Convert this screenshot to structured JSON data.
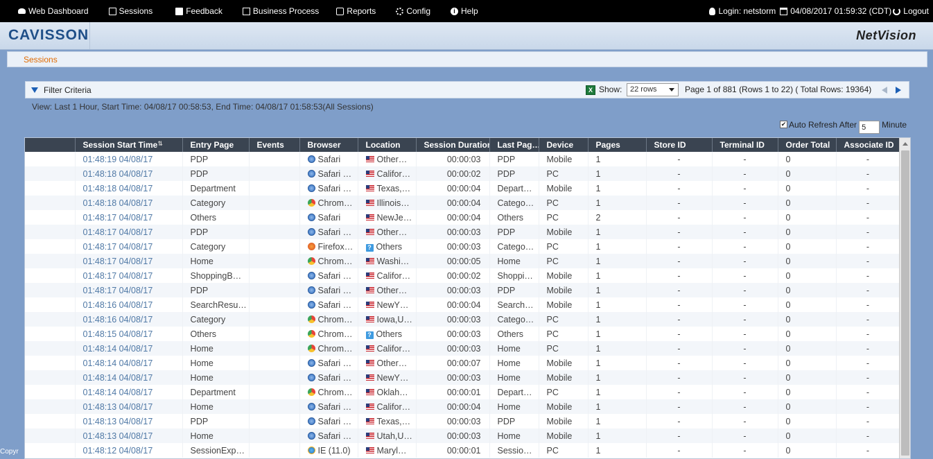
{
  "topnav": {
    "items": [
      {
        "label": "Web Dashboard",
        "icon": "dashboard-icon"
      },
      {
        "label": "Sessions",
        "icon": "sessions-icon"
      },
      {
        "label": "Feedback",
        "icon": "feedback-icon"
      },
      {
        "label": "Business Process",
        "icon": "business-process-icon"
      },
      {
        "label": "Reports",
        "icon": "reports-icon"
      },
      {
        "label": "Config",
        "icon": "config-icon"
      },
      {
        "label": "Help",
        "icon": "help-icon"
      }
    ],
    "login": "Login: netstorm",
    "datetime": "04/08/2017 01:59:32 (CDT)",
    "logout": "Logout"
  },
  "brand": {
    "logo": "CAVISSON",
    "product": "NetVision"
  },
  "breadcrumb": "Sessions",
  "filter": {
    "label": "Filter Criteria",
    "show_label": "Show:",
    "rows_value": "22 rows",
    "page_info": "Page 1 of 881 (Rows 1 to 22) ( Total Rows: 19364)"
  },
  "view_text": "View: Last 1 Hour, Start Time: 04/08/17 00:58:53, End Time: 04/08/17 01:58:53(All Sessions)",
  "auto_refresh": {
    "label": "Auto Refresh After",
    "value": "5",
    "unit": "Minute",
    "checked": true
  },
  "table": {
    "columns": [
      "",
      "Session Start Time",
      "Entry Page",
      "Events",
      "Browser",
      "Location",
      "Session Duration",
      "Last Pag…",
      "Device",
      "Pages",
      "Store ID",
      "Terminal ID",
      "Order Total",
      "Associate ID"
    ],
    "rows": [
      [
        "01:48:19 04/08/17",
        "PDP",
        "",
        "safari",
        "Safari",
        "flag",
        "Other…",
        "00:00:03",
        "PDP",
        "Mobile",
        "1",
        "-",
        "-",
        "0",
        "-"
      ],
      [
        "01:48:18 04/08/17",
        "PDP",
        "",
        "safari",
        "Safari …",
        "flag",
        "Califor…",
        "00:00:02",
        "PDP",
        "PC",
        "1",
        "-",
        "-",
        "0",
        "-"
      ],
      [
        "01:48:18 04/08/17",
        "Department",
        "",
        "safari",
        "Safari …",
        "flag",
        "Texas,…",
        "00:00:04",
        "Depart…",
        "Mobile",
        "1",
        "-",
        "-",
        "0",
        "-"
      ],
      [
        "01:48:18 04/08/17",
        "Category",
        "",
        "chrome",
        "Chrom…",
        "flag",
        "Illinois…",
        "00:00:04",
        "Catego…",
        "PC",
        "1",
        "-",
        "-",
        "0",
        "-"
      ],
      [
        "01:48:17 04/08/17",
        "Others",
        "",
        "safari",
        "Safari",
        "flag",
        "NewJe…",
        "00:00:04",
        "Others",
        "PC",
        "2",
        "-",
        "-",
        "0",
        "-"
      ],
      [
        "01:48:17 04/08/17",
        "PDP",
        "",
        "safari",
        "Safari …",
        "flag",
        "Other…",
        "00:00:03",
        "PDP",
        "Mobile",
        "1",
        "-",
        "-",
        "0",
        "-"
      ],
      [
        "01:48:17 04/08/17",
        "Category",
        "",
        "firefox",
        "Firefox…",
        "q",
        "Others",
        "00:00:03",
        "Catego…",
        "PC",
        "1",
        "-",
        "-",
        "0",
        "-"
      ],
      [
        "01:48:17 04/08/17",
        "Home",
        "",
        "chrome",
        "Chrom…",
        "flag",
        "Washi…",
        "00:00:05",
        "Home",
        "PC",
        "1",
        "-",
        "-",
        "0",
        "-"
      ],
      [
        "01:48:17 04/08/17",
        "ShoppingB…",
        "",
        "safari",
        "Safari …",
        "flag",
        "Califor…",
        "00:00:02",
        "Shoppi…",
        "Mobile",
        "1",
        "-",
        "-",
        "0",
        "-"
      ],
      [
        "01:48:17 04/08/17",
        "PDP",
        "",
        "safari",
        "Safari …",
        "flag",
        "Other…",
        "00:00:03",
        "PDP",
        "Mobile",
        "1",
        "-",
        "-",
        "0",
        "-"
      ],
      [
        "01:48:16 04/08/17",
        "SearchResu…",
        "",
        "safari",
        "Safari …",
        "flag",
        "NewY…",
        "00:00:04",
        "Search…",
        "Mobile",
        "1",
        "-",
        "-",
        "0",
        "-"
      ],
      [
        "01:48:16 04/08/17",
        "Category",
        "",
        "chrome",
        "Chrom…",
        "flag",
        "Iowa,U…",
        "00:00:03",
        "Catego…",
        "PC",
        "1",
        "-",
        "-",
        "0",
        "-"
      ],
      [
        "01:48:15 04/08/17",
        "Others",
        "",
        "chrome",
        "Chrom…",
        "q",
        "Others",
        "00:00:03",
        "Others",
        "PC",
        "1",
        "-",
        "-",
        "0",
        "-"
      ],
      [
        "01:48:14 04/08/17",
        "Home",
        "",
        "chrome",
        "Chrom…",
        "flag",
        "Califor…",
        "00:00:03",
        "Home",
        "PC",
        "1",
        "-",
        "-",
        "0",
        "-"
      ],
      [
        "01:48:14 04/08/17",
        "Home",
        "",
        "safari",
        "Safari …",
        "flag",
        "Other…",
        "00:00:07",
        "Home",
        "Mobile",
        "1",
        "-",
        "-",
        "0",
        "-"
      ],
      [
        "01:48:14 04/08/17",
        "Home",
        "",
        "safari",
        "Safari …",
        "flag",
        "NewY…",
        "00:00:03",
        "Home",
        "Mobile",
        "1",
        "-",
        "-",
        "0",
        "-"
      ],
      [
        "01:48:14 04/08/17",
        "Department",
        "",
        "chrome",
        "Chrom…",
        "flag",
        "Oklah…",
        "00:00:01",
        "Depart…",
        "PC",
        "1",
        "-",
        "-",
        "0",
        "-"
      ],
      [
        "01:48:13 04/08/17",
        "Home",
        "",
        "safari",
        "Safari …",
        "flag",
        "Califor…",
        "00:00:04",
        "Home",
        "Mobile",
        "1",
        "-",
        "-",
        "0",
        "-"
      ],
      [
        "01:48:13 04/08/17",
        "PDP",
        "",
        "safari",
        "Safari …",
        "flag",
        "Texas,…",
        "00:00:03",
        "PDP",
        "Mobile",
        "1",
        "-",
        "-",
        "0",
        "-"
      ],
      [
        "01:48:13 04/08/17",
        "Home",
        "",
        "safari",
        "Safari …",
        "flag",
        "Utah,U…",
        "00:00:03",
        "Home",
        "Mobile",
        "1",
        "-",
        "-",
        "0",
        "-"
      ],
      [
        "01:48:12 04/08/17",
        "SessionExp…",
        "",
        "ie",
        "IE (11.0)",
        "flag",
        "Maryl…",
        "00:00:01",
        "Sessio…",
        "PC",
        "1",
        "-",
        "-",
        "0",
        "-"
      ]
    ]
  },
  "copyright": "Copyr"
}
